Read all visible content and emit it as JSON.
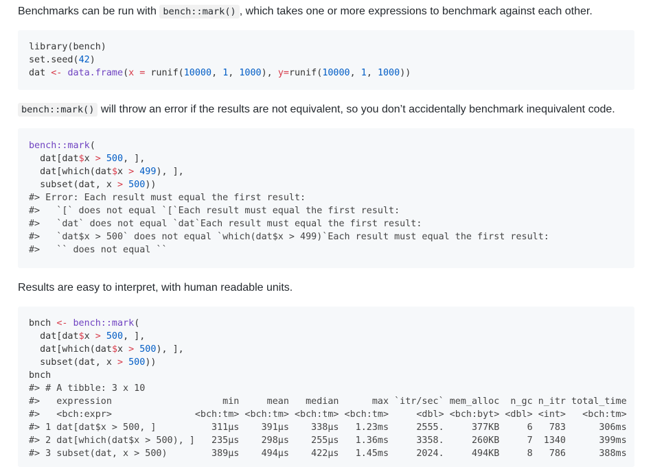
{
  "para1": {
    "before": "Benchmarks can be run with ",
    "code": "bench::mark()",
    "after": ", which takes one or more expressions to benchmark against each other."
  },
  "block1": [
    "library(bench)",
    "set.seed(42)",
    "dat <- data.frame(x = runif(10000, 1, 1000), y=runif(10000, 1, 1000))"
  ],
  "para2": {
    "code": "bench::mark()",
    "after": " will throw an error if the results are not equivalent, so you don’t accidentally benchmark inequivalent code."
  },
  "block2": [
    "bench::mark(",
    "  dat[dat$x > 500, ],",
    "  dat[which(dat$x > 499), ],",
    "  subset(dat, x > 500))",
    "#> Error: Each result must equal the first result:",
    "#>   `[` does not equal `[`Each result must equal the first result:",
    "#>   `dat` does not equal `dat`Each result must equal the first result:",
    "#>   `dat$x > 500` does not equal `which(dat$x > 499)`Each result must equal the first result:",
    "#>   `` does not equal ``"
  ],
  "para3": {
    "text": "Results are easy to interpret, with human readable units."
  },
  "block3": [
    "bnch <- bench::mark(",
    "  dat[dat$x > 500, ],",
    "  dat[which(dat$x > 500), ],",
    "  subset(dat, x > 500))",
    "bnch",
    "#> # A tibble: 3 x 10",
    "#>   expression                    min     mean   median      max `itr/sec` mem_alloc  n_gc n_itr total_time",
    "#>   <bch:expr>               <bch:tm> <bch:tm> <bch:tm> <bch:tm>     <dbl> <bch:byt> <dbl> <int>   <bch:tm>",
    "#> 1 dat[dat$x > 500, ]          311µs    391µs    338µs   1.23ms     2555.     377KB     6   783      306ms",
    "#> 2 dat[which(dat$x > 500), ]   235µs    298µs    255µs   1.36ms     3358.     260KB     7  1340      399ms",
    "#> 3 subset(dat, x > 500)        389µs    494µs    422µs   1.45ms     2024.     494KB     8   786      388ms"
  ]
}
